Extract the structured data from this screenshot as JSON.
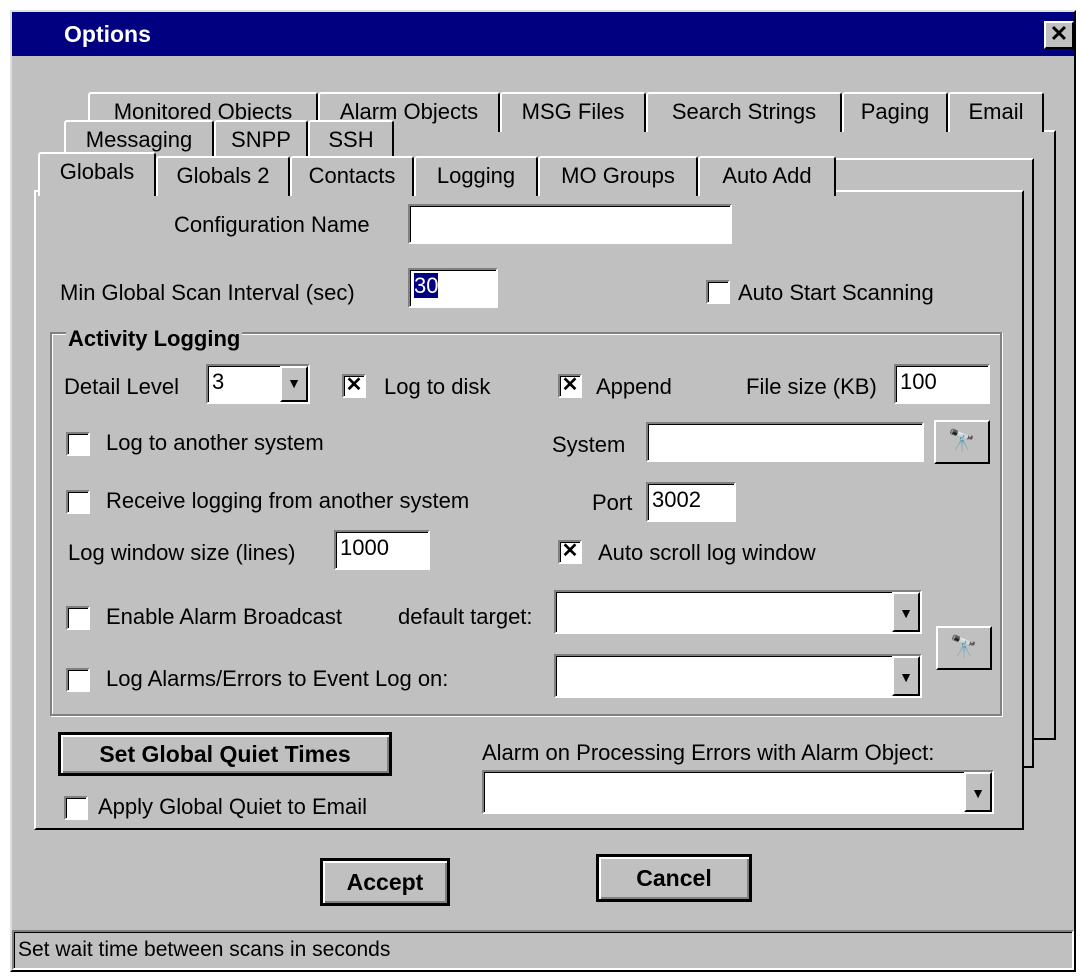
{
  "window": {
    "title": "Options",
    "close_glyph": "✕"
  },
  "tabs": {
    "row1": [
      "Monitored Objects",
      "Alarm Objects",
      "MSG Files",
      "Search Strings",
      "Paging",
      "Email"
    ],
    "row2": [
      "Messaging",
      "SNPP",
      "SSH"
    ],
    "row3": [
      "Globals",
      "Globals 2",
      "Contacts",
      "Logging",
      "MO Groups",
      "Auto Add"
    ],
    "active": "Globals"
  },
  "globals": {
    "config_name_label": "Configuration Name",
    "config_name_value": "",
    "scan_interval_label": "Min Global Scan Interval (sec)",
    "scan_interval_value": "30",
    "auto_start_label": "Auto Start Scanning",
    "auto_start_checked": false
  },
  "activity_logging": {
    "group_label": "Activity Logging",
    "detail_level_label": "Detail Level",
    "detail_level_value": "3",
    "log_to_disk_label": "Log to disk",
    "log_to_disk_checked": true,
    "append_label": "Append",
    "append_checked": true,
    "file_size_label": "File size (KB)",
    "file_size_value": "100",
    "log_to_another_label": "Log to another system",
    "log_to_another_checked": false,
    "system_label": "System",
    "system_value": "",
    "receive_logging_label": "Receive logging from another system",
    "receive_logging_checked": false,
    "port_label": "Port",
    "port_value": "3002",
    "log_window_label": "Log window size (lines)",
    "log_window_value": "1000",
    "auto_scroll_label": "Auto scroll log window",
    "auto_scroll_checked": true,
    "alarm_broadcast_label": "Enable Alarm Broadcast",
    "alarm_broadcast_checked": false,
    "default_target_label": "default target:",
    "default_target_value": "",
    "log_alarms_label": "Log Alarms/Errors to Event Log on:",
    "log_alarms_checked": false,
    "event_log_value": ""
  },
  "quiet": {
    "set_quiet_button": "Set Global Quiet Times",
    "apply_quiet_label": "Apply Global Quiet to Email",
    "apply_quiet_checked": false,
    "alarm_processing_label": "Alarm on Processing Errors with Alarm Object:",
    "alarm_processing_value": ""
  },
  "buttons": {
    "accept": "Accept",
    "cancel": "Cancel"
  },
  "status": "Set wait time between scans in seconds",
  "icons": {
    "binoculars": "binoculars-icon",
    "dropdown": "chevron-down-icon"
  }
}
